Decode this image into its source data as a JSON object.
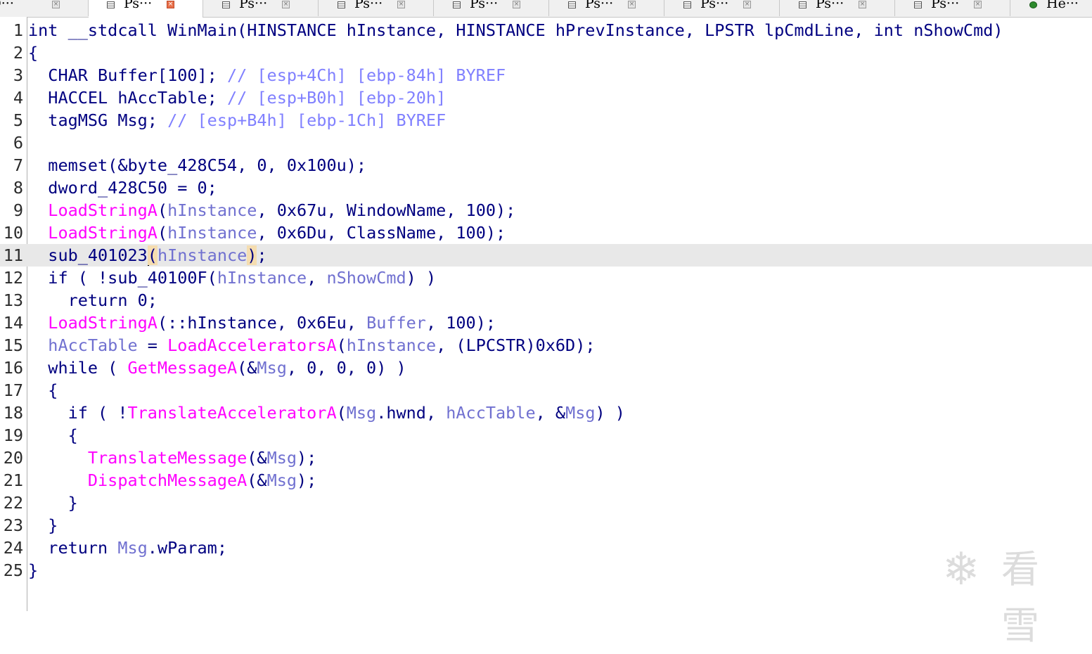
{
  "tabs": [
    {
      "label": "ID···",
      "icon": "none",
      "active": false
    },
    {
      "label": "Ps···",
      "icon": "pseudocode-icon",
      "active": true
    },
    {
      "label": "Ps···",
      "icon": "pseudocode-icon",
      "active": false
    },
    {
      "label": "Ps···",
      "icon": "pseudocode-icon",
      "active": false
    },
    {
      "label": "Ps···",
      "icon": "pseudocode-icon",
      "active": false
    },
    {
      "label": "Ps···",
      "icon": "pseudocode-icon",
      "active": false
    },
    {
      "label": "Ps···",
      "icon": "pseudocode-icon",
      "active": false
    },
    {
      "label": "Ps···",
      "icon": "pseudocode-icon",
      "active": false
    },
    {
      "label": "Ps···",
      "icon": "pseudocode-icon",
      "active": false
    },
    {
      "label": "He···",
      "icon": "hex-view-icon",
      "active": false
    }
  ],
  "close_glyph": "×",
  "code": {
    "lines": [
      {
        "n": "1",
        "segs": [
          {
            "t": "int __stdcall WinMain(HINSTANCE hInstance, HINSTANCE hPrevInstance, LPSTR lpCmdLine, int nShowCmd)"
          }
        ]
      },
      {
        "n": "2",
        "segs": [
          {
            "t": "{"
          }
        ]
      },
      {
        "n": "3",
        "segs": [
          {
            "t": "  CHAR Buffer[100]; "
          },
          {
            "t": "// [esp+4Ch] [ebp-84h] BYREF",
            "c": "cm"
          }
        ]
      },
      {
        "n": "4",
        "segs": [
          {
            "t": "  HACCEL hAccTable; "
          },
          {
            "t": "// [esp+B0h] [ebp-20h]",
            "c": "cm"
          }
        ]
      },
      {
        "n": "5",
        "segs": [
          {
            "t": "  tagMSG Msg; "
          },
          {
            "t": "// [esp+B4h] [ebp-1Ch] BYREF",
            "c": "cm"
          }
        ]
      },
      {
        "n": "6",
        "segs": []
      },
      {
        "n": "7",
        "segs": [
          {
            "t": "  memset(&byte_428C54, 0, 0x100u);"
          }
        ]
      },
      {
        "n": "8",
        "segs": [
          {
            "t": "  dword_428C50 = 0;"
          }
        ]
      },
      {
        "n": "9",
        "segs": [
          {
            "t": "  "
          },
          {
            "t": "LoadStringA",
            "c": "fn"
          },
          {
            "t": "("
          },
          {
            "t": "hInstance",
            "c": "pv"
          },
          {
            "t": ", 0x67u, WindowName, 100);"
          }
        ]
      },
      {
        "n": "10",
        "segs": [
          {
            "t": "  "
          },
          {
            "t": "LoadStringA",
            "c": "fn"
          },
          {
            "t": "("
          },
          {
            "t": "hInstance",
            "c": "pv"
          },
          {
            "t": ", 0x6Du, ClassName, 100);"
          }
        ]
      },
      {
        "n": "11",
        "hl": true,
        "segs": [
          {
            "t": "  sub_401023"
          },
          {
            "caret": true
          },
          {
            "t": "(",
            "c": "pb"
          },
          {
            "t": "hInstance",
            "c": "pv"
          },
          {
            "t": ")",
            "c": "pb"
          },
          {
            "t": ";"
          }
        ]
      },
      {
        "n": "12",
        "segs": [
          {
            "t": "  if ( !sub_40100F("
          },
          {
            "t": "hInstance",
            "c": "pv"
          },
          {
            "t": ", "
          },
          {
            "t": "nShowCmd",
            "c": "pv"
          },
          {
            "t": ") )"
          }
        ]
      },
      {
        "n": "13",
        "segs": [
          {
            "t": "    return 0;"
          }
        ]
      },
      {
        "n": "14",
        "segs": [
          {
            "t": "  "
          },
          {
            "t": "LoadStringA",
            "c": "fn"
          },
          {
            "t": "(::hInstance, 0x6Eu, "
          },
          {
            "t": "Buffer",
            "c": "pv"
          },
          {
            "t": ", 100);"
          }
        ]
      },
      {
        "n": "15",
        "segs": [
          {
            "t": "  "
          },
          {
            "t": "hAccTable",
            "c": "pv"
          },
          {
            "t": " = "
          },
          {
            "t": "LoadAcceleratorsA",
            "c": "fn"
          },
          {
            "t": "("
          },
          {
            "t": "hInstance",
            "c": "pv"
          },
          {
            "t": ", (LPCSTR)0x6D);"
          }
        ]
      },
      {
        "n": "16",
        "segs": [
          {
            "t": "  while ( "
          },
          {
            "t": "GetMessageA",
            "c": "fn"
          },
          {
            "t": "(&"
          },
          {
            "t": "Msg",
            "c": "pv"
          },
          {
            "t": ", 0, 0, 0) )"
          }
        ]
      },
      {
        "n": "17",
        "segs": [
          {
            "t": "  {"
          }
        ]
      },
      {
        "n": "18",
        "segs": [
          {
            "t": "    if ( !"
          },
          {
            "t": "TranslateAcceleratorA",
            "c": "fn"
          },
          {
            "t": "("
          },
          {
            "t": "Msg",
            "c": "pv"
          },
          {
            "t": ".hwnd, "
          },
          {
            "t": "hAccTable",
            "c": "pv"
          },
          {
            "t": ", &"
          },
          {
            "t": "Msg",
            "c": "pv"
          },
          {
            "t": ") )"
          }
        ]
      },
      {
        "n": "19",
        "segs": [
          {
            "t": "    {"
          }
        ]
      },
      {
        "n": "20",
        "segs": [
          {
            "t": "      "
          },
          {
            "t": "TranslateMessage",
            "c": "fn"
          },
          {
            "t": "(&"
          },
          {
            "t": "Msg",
            "c": "pv"
          },
          {
            "t": ");"
          }
        ]
      },
      {
        "n": "21",
        "segs": [
          {
            "t": "      "
          },
          {
            "t": "DispatchMessageA",
            "c": "fn"
          },
          {
            "t": "(&"
          },
          {
            "t": "Msg",
            "c": "pv"
          },
          {
            "t": ");"
          }
        ]
      },
      {
        "n": "22",
        "segs": [
          {
            "t": "    }"
          }
        ]
      },
      {
        "n": "23",
        "segs": [
          {
            "t": "  }"
          }
        ]
      },
      {
        "n": "24",
        "segs": [
          {
            "t": "  return "
          },
          {
            "t": "Msg",
            "c": "pv"
          },
          {
            "t": ".wParam;"
          }
        ]
      },
      {
        "n": "25",
        "segs": [
          {
            "t": "}"
          }
        ]
      }
    ]
  },
  "watermark": {
    "glyph": "❄",
    "text": "看雪"
  }
}
